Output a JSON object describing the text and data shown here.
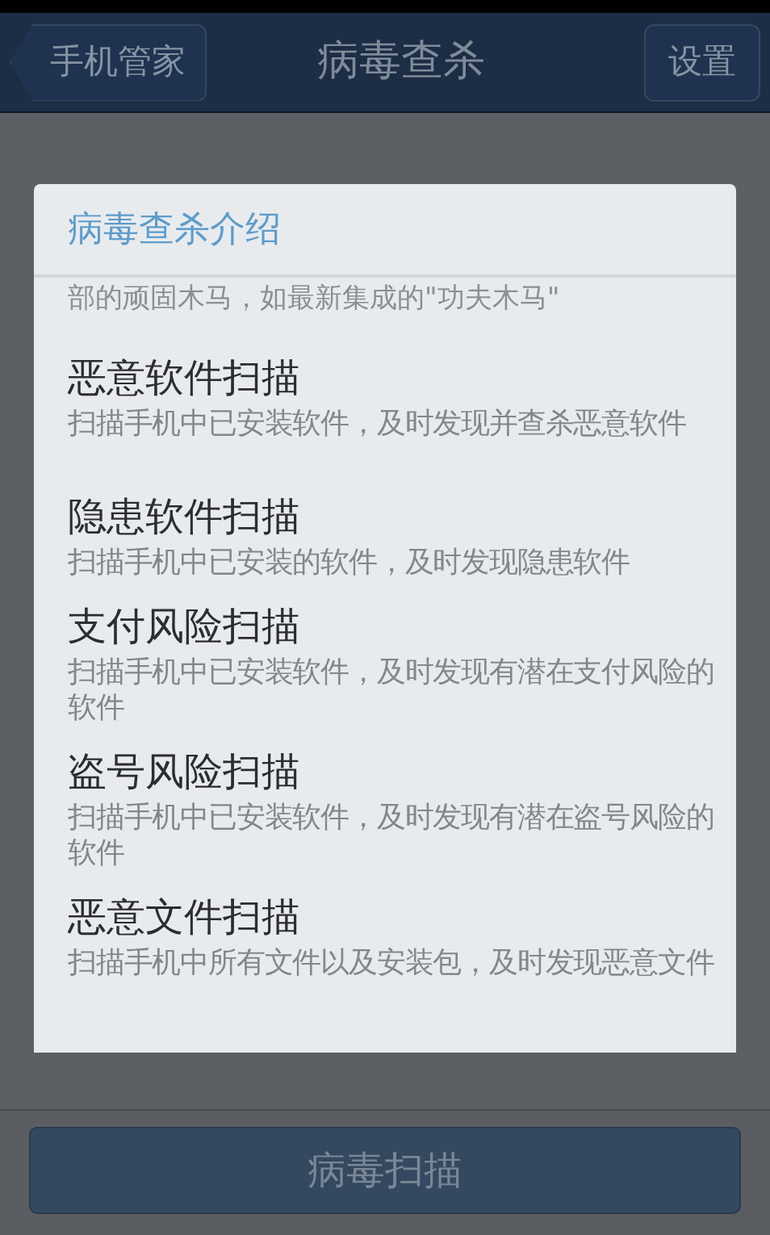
{
  "nav_bar": {
    "back_button": "手机管家",
    "title": "病毒查杀",
    "settings_button": "设置"
  },
  "dialog": {
    "title": "病毒查杀介绍",
    "cut_text": "部的顽固木马，如最新集成的\"功夫木马\"",
    "items": [
      {
        "title": "恶意软件扫描",
        "description": "扫描手机中已安装软件，及时发现并查杀恶意软件"
      },
      {
        "title": "隐患软件扫描",
        "description": "扫描手机中已安装的软件，及时发现隐患软件"
      },
      {
        "title": "支付风险扫描",
        "description": "扫描手机中已安装软件，及时发现有潜在支付风险的软件"
      },
      {
        "title": "盗号风险扫描",
        "description": "扫描手机中已安装软件，及时发现有潜在盗号风险的软件"
      },
      {
        "title": "恶意文件扫描",
        "description": "扫描手机中所有文件以及安装包，及时发现恶意文件"
      }
    ]
  },
  "scan_button": {
    "label": "病毒扫描"
  }
}
